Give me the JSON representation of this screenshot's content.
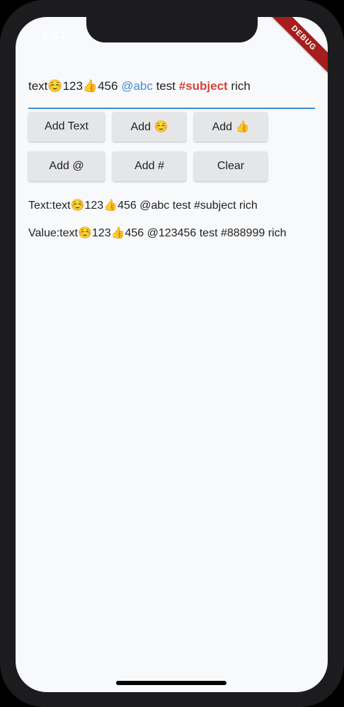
{
  "status_bar": {
    "time": "9:47"
  },
  "debug_banner": "DEBUG",
  "rich_input": {
    "prefix": "text☺️123👍456 ",
    "mention": "@abc",
    "middle": " test ",
    "subject": "#subject",
    "suffix": " rich"
  },
  "buttons": {
    "add_text": "Add Text",
    "add_emoji_smile": "Add ☺️",
    "add_emoji_thumb": "Add 👍",
    "add_at": "Add @",
    "add_hash": "Add #",
    "clear": "Clear"
  },
  "output": {
    "text_line": "Text:text☺️123👍456 @abc test #subject rich",
    "value_line": "Value:text☺️123👍456 @123456 test #888999 rich"
  },
  "colors": {
    "mention": "#3f8fd6",
    "subject": "#d0453c",
    "underline": "#3f8fd6",
    "button_bg": "#e5e6e8",
    "debug_banner": "#a51d1d"
  }
}
